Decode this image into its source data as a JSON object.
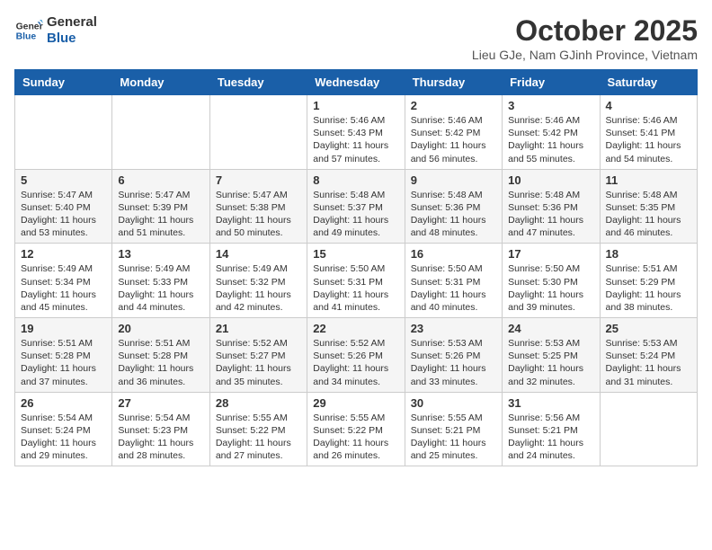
{
  "logo": {
    "line1": "General",
    "line2": "Blue"
  },
  "title": "October 2025",
  "subtitle": "Lieu GJe, Nam GJinh Province, Vietnam",
  "days_of_week": [
    "Sunday",
    "Monday",
    "Tuesday",
    "Wednesday",
    "Thursday",
    "Friday",
    "Saturday"
  ],
  "weeks": [
    [
      {
        "day": "",
        "info": ""
      },
      {
        "day": "",
        "info": ""
      },
      {
        "day": "",
        "info": ""
      },
      {
        "day": "1",
        "info": "Sunrise: 5:46 AM\nSunset: 5:43 PM\nDaylight: 11 hours and 57 minutes."
      },
      {
        "day": "2",
        "info": "Sunrise: 5:46 AM\nSunset: 5:42 PM\nDaylight: 11 hours and 56 minutes."
      },
      {
        "day": "3",
        "info": "Sunrise: 5:46 AM\nSunset: 5:42 PM\nDaylight: 11 hours and 55 minutes."
      },
      {
        "day": "4",
        "info": "Sunrise: 5:46 AM\nSunset: 5:41 PM\nDaylight: 11 hours and 54 minutes."
      }
    ],
    [
      {
        "day": "5",
        "info": "Sunrise: 5:47 AM\nSunset: 5:40 PM\nDaylight: 11 hours and 53 minutes."
      },
      {
        "day": "6",
        "info": "Sunrise: 5:47 AM\nSunset: 5:39 PM\nDaylight: 11 hours and 51 minutes."
      },
      {
        "day": "7",
        "info": "Sunrise: 5:47 AM\nSunset: 5:38 PM\nDaylight: 11 hours and 50 minutes."
      },
      {
        "day": "8",
        "info": "Sunrise: 5:48 AM\nSunset: 5:37 PM\nDaylight: 11 hours and 49 minutes."
      },
      {
        "day": "9",
        "info": "Sunrise: 5:48 AM\nSunset: 5:36 PM\nDaylight: 11 hours and 48 minutes."
      },
      {
        "day": "10",
        "info": "Sunrise: 5:48 AM\nSunset: 5:36 PM\nDaylight: 11 hours and 47 minutes."
      },
      {
        "day": "11",
        "info": "Sunrise: 5:48 AM\nSunset: 5:35 PM\nDaylight: 11 hours and 46 minutes."
      }
    ],
    [
      {
        "day": "12",
        "info": "Sunrise: 5:49 AM\nSunset: 5:34 PM\nDaylight: 11 hours and 45 minutes."
      },
      {
        "day": "13",
        "info": "Sunrise: 5:49 AM\nSunset: 5:33 PM\nDaylight: 11 hours and 44 minutes."
      },
      {
        "day": "14",
        "info": "Sunrise: 5:49 AM\nSunset: 5:32 PM\nDaylight: 11 hours and 42 minutes."
      },
      {
        "day": "15",
        "info": "Sunrise: 5:50 AM\nSunset: 5:31 PM\nDaylight: 11 hours and 41 minutes."
      },
      {
        "day": "16",
        "info": "Sunrise: 5:50 AM\nSunset: 5:31 PM\nDaylight: 11 hours and 40 minutes."
      },
      {
        "day": "17",
        "info": "Sunrise: 5:50 AM\nSunset: 5:30 PM\nDaylight: 11 hours and 39 minutes."
      },
      {
        "day": "18",
        "info": "Sunrise: 5:51 AM\nSunset: 5:29 PM\nDaylight: 11 hours and 38 minutes."
      }
    ],
    [
      {
        "day": "19",
        "info": "Sunrise: 5:51 AM\nSunset: 5:28 PM\nDaylight: 11 hours and 37 minutes."
      },
      {
        "day": "20",
        "info": "Sunrise: 5:51 AM\nSunset: 5:28 PM\nDaylight: 11 hours and 36 minutes."
      },
      {
        "day": "21",
        "info": "Sunrise: 5:52 AM\nSunset: 5:27 PM\nDaylight: 11 hours and 35 minutes."
      },
      {
        "day": "22",
        "info": "Sunrise: 5:52 AM\nSunset: 5:26 PM\nDaylight: 11 hours and 34 minutes."
      },
      {
        "day": "23",
        "info": "Sunrise: 5:53 AM\nSunset: 5:26 PM\nDaylight: 11 hours and 33 minutes."
      },
      {
        "day": "24",
        "info": "Sunrise: 5:53 AM\nSunset: 5:25 PM\nDaylight: 11 hours and 32 minutes."
      },
      {
        "day": "25",
        "info": "Sunrise: 5:53 AM\nSunset: 5:24 PM\nDaylight: 11 hours and 31 minutes."
      }
    ],
    [
      {
        "day": "26",
        "info": "Sunrise: 5:54 AM\nSunset: 5:24 PM\nDaylight: 11 hours and 29 minutes."
      },
      {
        "day": "27",
        "info": "Sunrise: 5:54 AM\nSunset: 5:23 PM\nDaylight: 11 hours and 28 minutes."
      },
      {
        "day": "28",
        "info": "Sunrise: 5:55 AM\nSunset: 5:22 PM\nDaylight: 11 hours and 27 minutes."
      },
      {
        "day": "29",
        "info": "Sunrise: 5:55 AM\nSunset: 5:22 PM\nDaylight: 11 hours and 26 minutes."
      },
      {
        "day": "30",
        "info": "Sunrise: 5:55 AM\nSunset: 5:21 PM\nDaylight: 11 hours and 25 minutes."
      },
      {
        "day": "31",
        "info": "Sunrise: 5:56 AM\nSunset: 5:21 PM\nDaylight: 11 hours and 24 minutes."
      },
      {
        "day": "",
        "info": ""
      }
    ]
  ]
}
